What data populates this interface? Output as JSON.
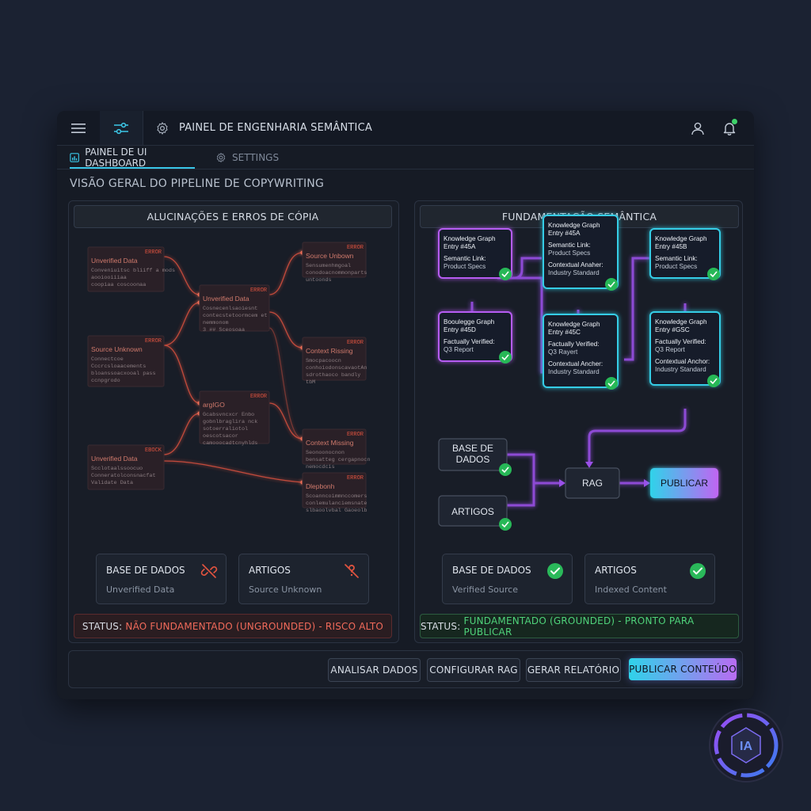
{
  "window": {
    "title": "PAINEL DE ENGENHARIA SEMÂNTICA",
    "icons": {
      "menu": "hamburger-icon",
      "filter": "sliders-icon",
      "settings": "gear-icon",
      "user": "user-icon",
      "notifications": "bell-icon"
    }
  },
  "tabs": [
    {
      "label": "PAINEL DE UI DASHBOARD",
      "icon": "dashboard-icon",
      "active": true
    },
    {
      "label": "SETTINGS",
      "icon": "gear-icon",
      "active": false
    }
  ],
  "section_title": "VISÃO GERAL DO PIPELINE DE COPYWRITING",
  "left_panel": {
    "title": "ALUCINAÇÕES E ERROS DE CÓPIA",
    "error_nodes": [
      {
        "tag": "ERROR",
        "title": "Unverified Data",
        "lines": [
          "Conveniuitsc bliiff a mods",
          "aooiooiiiaa",
          "coopiaa coscoonaa"
        ]
      },
      {
        "tag": "ERROR",
        "title": "Source Unknown",
        "lines": [
          "Connectcoe",
          "Cccrcsloaacements",
          "bloanssoacxooal pass",
          "ccnpgrodo"
        ]
      },
      {
        "tag": "EBOCK",
        "title": "Unverified Data",
        "lines": [
          "Scclotaalssoocuo",
          "Conneratolconsnacfat",
          "Validate Data"
        ]
      },
      {
        "tag": "ERROR",
        "title": "Unverified Data",
        "lines": [
          "Cosnecenlsaoiesnt",
          "contecstetoormcem et",
          "nemmonom",
          "3 ## Sceosoaa"
        ]
      },
      {
        "tag": "ERROR",
        "title": "argIGO",
        "lines": [
          "Gcabsvncxcr Enbo",
          "gobnlbraglira nck",
          "sotoerraliotol",
          "oescotsacor",
          "camooocadtcnyhlds"
        ]
      },
      {
        "tag": "ERROR",
        "title": "Source Unbown",
        "lines": [
          "Sensumenhmgoal",
          "conodoacnommonparts",
          "untoonds"
        ]
      },
      {
        "tag": "ERROR",
        "title": "Context Rissing",
        "lines": [
          "Smocpacoocn",
          "conhoiodonscavaotAn",
          "sdrothaoco bandly",
          "tbM"
        ]
      },
      {
        "tag": "ERROR",
        "title": "Context Missing",
        "lines": [
          "Seonoonocnon",
          "bensatteg cergapnocn",
          "nemocdcis"
        ]
      },
      {
        "tag": "ERROR",
        "title": "Dlepbonh",
        "lines": [
          "Scoanncoimmnccomers",
          "conlemulanciemsnate",
          "slbaoolvbal Gaoeolb"
        ]
      }
    ],
    "cards": [
      {
        "title": "BASE DE DADOS",
        "subtitle": "Unverified Data",
        "icon": "broken-link-icon"
      },
      {
        "title": "ARTIGOS",
        "subtitle": "Source Unknown",
        "icon": "unverified-document-icon"
      }
    ],
    "status_label": "STATUS:",
    "status_value": "NÃO FUNDAMENTADO (UNGROUNDED) - RISCO ALTO",
    "status_color": "#f06a5a"
  },
  "right_panel": {
    "title": "FUNDAMENTAÇÃO SEMÂNTICA",
    "kg_nodes": [
      {
        "l1": "Knowledge Graph",
        "l2": "Entry #45A",
        "l3": "Semantic Link:",
        "l4": "Product Specs",
        "l5": "",
        "l6": "",
        "color": "#b65cf2"
      },
      {
        "l1": "Knowledge Graph",
        "l2": "Entry #45A",
        "l3": "Semantic Link:",
        "l4": "Product Specs",
        "l5": "Contextual Anaher:",
        "l6": "Industry Standard",
        "color": "#34cde6"
      },
      {
        "l1": "Knowledge Graph",
        "l2": "Entry #45B",
        "l3": "Semantic Link:",
        "l4": "Product Specs",
        "l5": "",
        "l6": "",
        "color": "#34cde6"
      },
      {
        "l1": "Booulegge Graph",
        "l2": "Entry #45D",
        "l3": "Factually Verified:",
        "l4": "Q3 Report",
        "l5": "",
        "l6": "",
        "color": "#b65cf2"
      },
      {
        "l1": "Knowledge Graph",
        "l2": "Entry #45C",
        "l3": "Factually Verified:",
        "l4": "Q3 Rayert",
        "l5": "Contextual Ancher:",
        "l6": "Industry Standard",
        "color": "#34cde6"
      },
      {
        "l1": "Knowledge Graph",
        "l2": "Entry #GSC",
        "l3": "Factually Verified:",
        "l4": "Q3 Report",
        "l5": "Contextual Anchor:",
        "l6": "Industry Standard",
        "color": "#34cde6"
      }
    ],
    "pipeline": {
      "source_db": "BASE DE DADOS",
      "source_articles": "ARTIGOS",
      "rag": "RAG",
      "publish": "PUBLICAR"
    },
    "cards": [
      {
        "title": "BASE DE DADOS",
        "subtitle": "Verified Source",
        "icon": "check-circle-icon"
      },
      {
        "title": "ARTIGOS",
        "subtitle": "Indexed Content",
        "icon": "check-circle-icon"
      }
    ],
    "status_label": "STATUS:",
    "status_value": "FUNDAMENTADO (GROUNDED) - PRONTO PARA PUBLICAR",
    "status_color": "#4fd27a"
  },
  "actions": [
    {
      "label": "ANALISAR DADOS",
      "primary": false
    },
    {
      "label": "CONFIGURAR RAG",
      "primary": false
    },
    {
      "label": "GERAR RELATÓRIO",
      "primary": false
    },
    {
      "label": "PUBLICAR CONTEÚDO",
      "primary": true
    }
  ],
  "badge": {
    "text": "IA",
    "icon": "ai-badge-icon"
  },
  "colors": {
    "error": "#e0533f",
    "purple": "#b65cf2",
    "cyan": "#34cde6",
    "success": "#3ed26a"
  }
}
